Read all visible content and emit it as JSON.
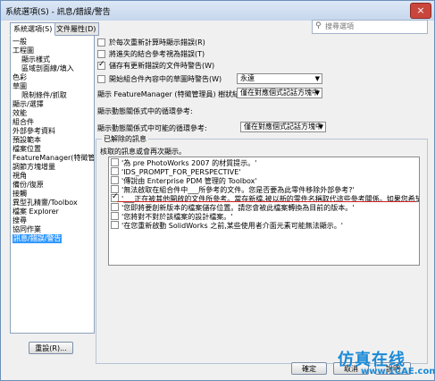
{
  "window": {
    "title": "系統選項(S) - 訊息/錯誤/警告",
    "close_label": "×"
  },
  "tabs": [
    {
      "label": "系統選項(S)"
    },
    {
      "label": "文件屬性(D)"
    }
  ],
  "search": {
    "placeholder": "搜尋選項"
  },
  "nav": {
    "items": [
      {
        "label": "一般"
      },
      {
        "label": "工程圖"
      },
      {
        "label": "顯示樣式"
      },
      {
        "label": "區域剖面線/填入"
      },
      {
        "label": "色彩"
      },
      {
        "label": "草圖"
      },
      {
        "label": "限制條件/抓取"
      },
      {
        "label": "顯示/選擇"
      },
      {
        "label": "效能"
      },
      {
        "label": "組合件"
      },
      {
        "label": "外部參考資料"
      },
      {
        "label": "預設範本"
      },
      {
        "label": "檔案位置"
      },
      {
        "label": "FeatureManager(特徵管理員)"
      },
      {
        "label": "調節方塊增量"
      },
      {
        "label": "視角"
      },
      {
        "label": "備份/復原"
      },
      {
        "label": "接觸"
      },
      {
        "label": "異型孔精靈/Toolbox"
      },
      {
        "label": "檔案 Explorer"
      },
      {
        "label": "搜尋"
      },
      {
        "label": "協同作業"
      },
      {
        "label": "訊息/錯誤/警告"
      }
    ],
    "reset_label": "重設(R)..."
  },
  "options": {
    "opt1": "於每次重新計算時顯示錯誤(R)",
    "opt2": "將進失的結合參考視為錯誤(T)",
    "opt3": "儲存有更新錯誤的文件時警告(W)",
    "opt4": "開始組合件內容中的草圖時警告(W)",
    "opt4_value": "永遠",
    "opt5": "顯示 FeatureManager (特徵管理員) 樹狀結構警告:",
    "opt5_value": "僅在對應個式記話方塊中",
    "opt6": "顯示動態關係式中的循環參考:",
    "opt7": "顯示動態關係式中可能的循環參考:",
    "opt7_value": "僅在對應個式記話方塊中"
  },
  "dismissed": {
    "group_title": "已解除的訊息",
    "hint": "核取的訊息或會再次顯示。",
    "items": [
      {
        "text": "'為 pre PhotoWorks 2007 的材質提示。'",
        "checked": false
      },
      {
        "text": "'IDS_PROMPT_FOR_PERSPECTIVE'",
        "checked": false
      },
      {
        "text": "'傳說由 Enterprise PDM 管理的 Toolbox'",
        "checked": false
      },
      {
        "text": "'無法啟取在組合件中___所參考的文件。您是否要為此零件移除外部參考?'",
        "checked": false
      },
      {
        "text": "'___正在被其他開啟的文件所參考。當存新檔,被以新的零件名稱取代這些參考關係。如果您希望維持其他的參考關係,'",
        "checked": true
      },
      {
        "text": "'您即將要創新版本的檔案儲存位置。請您會被此檔案轉換為目前的版本。'",
        "checked": false
      },
      {
        "text": "'您將對不對於該檔案的設計檔案。'",
        "checked": false
      },
      {
        "text": "'在您重新啟動 SolidWorks 之前,某些使用者介面元素可能無法顯示。'",
        "checked": false
      }
    ]
  },
  "buttons": {
    "ok": "確定",
    "cancel": "取消",
    "help": "說明"
  },
  "watermark": {
    "line1": "仿真在线",
    "line2": "www.1CAE.com"
  }
}
